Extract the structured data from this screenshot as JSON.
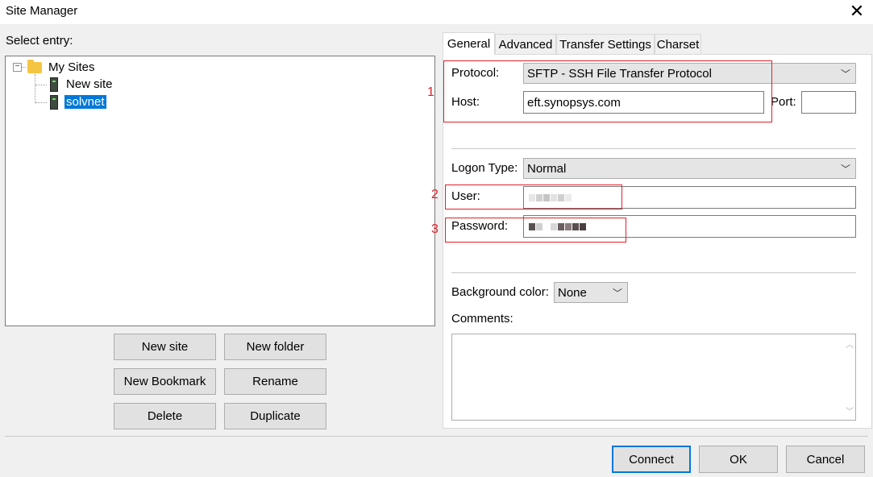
{
  "window": {
    "title": "Site Manager",
    "close": "✕"
  },
  "left": {
    "select_label": "Select entry:",
    "tree": {
      "root": {
        "label": "My Sites",
        "expander": "−"
      },
      "children": [
        {
          "label": "New site"
        },
        {
          "label": "solvnet"
        }
      ]
    },
    "buttons": {
      "new_site": "New site",
      "new_folder": "New folder",
      "new_bookmark": "New Bookmark",
      "rename": "Rename",
      "delete": "Delete",
      "duplicate": "Duplicate"
    }
  },
  "tabs": [
    "General",
    "Advanced",
    "Transfer Settings",
    "Charset"
  ],
  "general": {
    "protocol_label": "Protocol:",
    "protocol_value": "SFTP - SSH File Transfer Protocol",
    "host_label": "Host:",
    "host_value": "eft.synopsys.com",
    "port_label": "Port:",
    "port_value": "",
    "logon_type_label": "Logon Type:",
    "logon_type_value": "Normal",
    "user_label": "User:",
    "password_label": "Password:",
    "bg_color_label": "Background color:",
    "bg_color_value": "None",
    "comments_label": "Comments:"
  },
  "annotations": [
    "1",
    "2",
    "3"
  ],
  "footer": {
    "connect": "Connect",
    "ok": "OK",
    "cancel": "Cancel"
  },
  "colors": {
    "annotation_red": "#e0202a",
    "selection_blue": "#0078d7"
  }
}
